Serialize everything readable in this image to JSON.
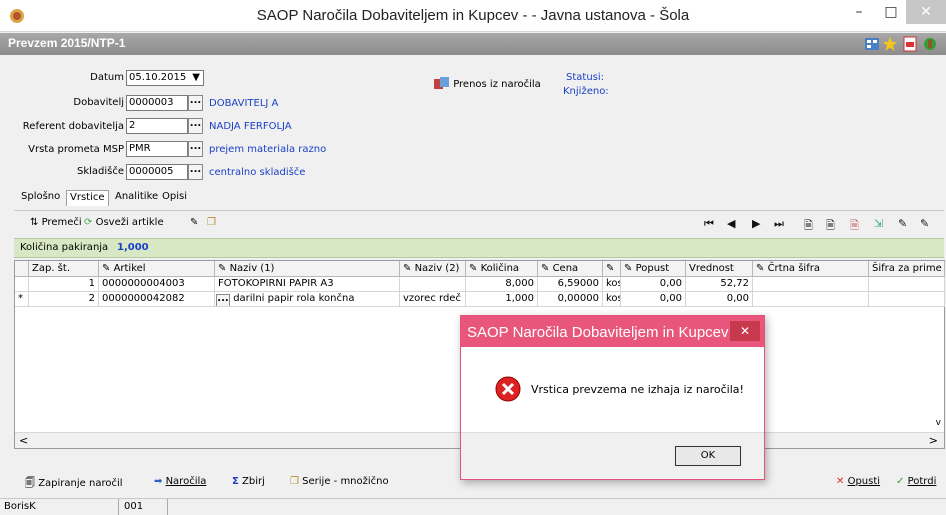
{
  "window": {
    "title": "SAOP  Naročila Dobaviteljem in Kupcev -  - Javna ustanova - Šola",
    "minimize": "–",
    "maximize": "□",
    "close": "✕"
  },
  "doc": {
    "title": "Prevzem 2015/NTP-1"
  },
  "form": {
    "datum_label": "Datum",
    "datum_value": "05.10.2015",
    "dobavitelj_label": "Dobavitelj",
    "dobavitelj_value": "0000003",
    "dobavitelj_name": "DOBAVITELJ  A",
    "referent_label": "Referent dobavitelja",
    "referent_value": "2",
    "referent_name": "NADJA FERFOLJA",
    "vrsta_label": "Vrsta prometa MSP",
    "vrsta_value": "PMR",
    "vrsta_name": "prejem materiala razno",
    "skladisce_label": "Skladišče",
    "skladisce_value": "0000005",
    "skladisce_name": "centralno skladišče",
    "prenos_label": "Prenos iz naročila",
    "statusi_label": "Statusi:",
    "status_value": "Knjiženo:"
  },
  "tabs": [
    "Splošno",
    "Vrstice",
    "Analitike",
    "Opisi"
  ],
  "toolbar": {
    "premeci": "Premeči",
    "osvezi": "Osveži artikle"
  },
  "pak": {
    "label": "Količina pakiranja",
    "value": "1,000"
  },
  "grid": {
    "headers": [
      "Zap. št.",
      "Artikel",
      "Naziv (1)",
      "Naziv (2)",
      "Količina",
      "Cena",
      "",
      "Popust",
      "Vrednost",
      "Črtna šifra",
      "Šifra za prime"
    ],
    "rows": [
      {
        "marker": "",
        "zap": "1",
        "artikel": "0000000004003",
        "naziv1": "FOTOKOPIRNI  PAPIR  A3",
        "naziv2": "",
        "kolicina": "8,000",
        "cena": "6,59000",
        "enota": "kos",
        "popust": "0,00",
        "vrednost": "52,72"
      },
      {
        "marker": "*",
        "zap": "2",
        "artikel": "0000000042082",
        "naziv1": "darilni papir rola končna",
        "naziv2": "vzorec rdeč",
        "kolicina": "1,000",
        "cena": "0,00000",
        "enota": "kos",
        "popust": "0,00",
        "vrednost": "0,00"
      }
    ]
  },
  "bottom": {
    "zapiranje": "Zapiranje naročil",
    "narocila": "Naročila",
    "zbiri": "Zbirj",
    "serije": "Serije - množično",
    "opusti": "Opusti",
    "potrdi": "Potrdi"
  },
  "status": {
    "user": "BorisK",
    "code": "001"
  },
  "dialog": {
    "title": "SAOP Naročila Dobaviteljem in Kupcev",
    "message": "Vrstica prevzema ne izhaja iz naročila!",
    "ok": "OK",
    "close": "✕"
  },
  "colors": {
    "dialog_accent": "#e8577b",
    "link_blue": "#1a3fc7",
    "pak_bar": "#d9e8c4"
  }
}
